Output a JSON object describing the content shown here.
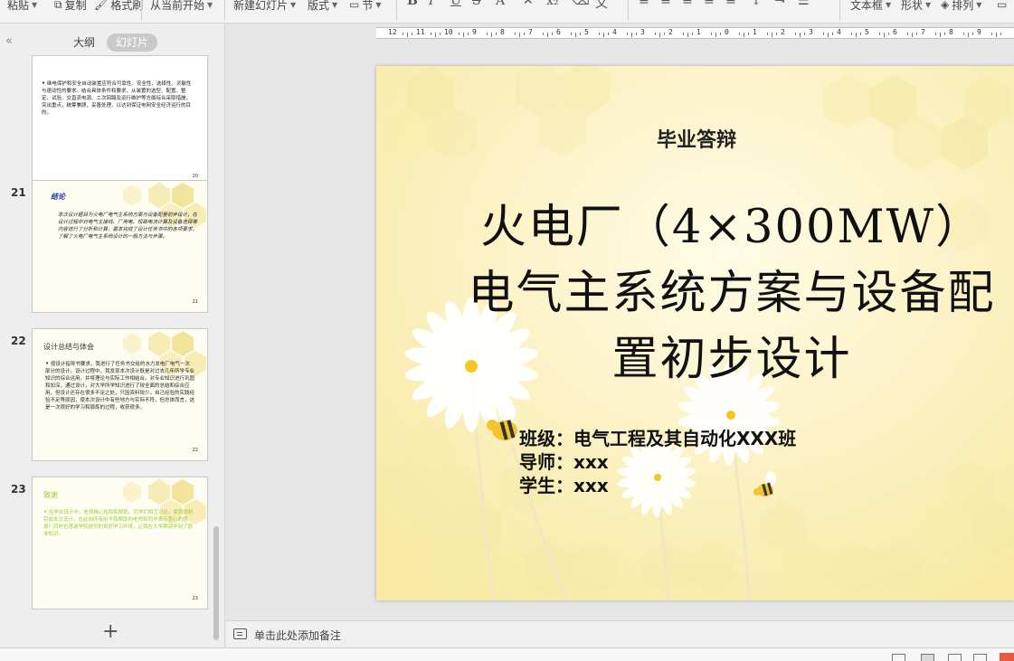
{
  "toolbar": {
    "paste": "粘贴",
    "copy": "复制",
    "format_painter": "格式刷",
    "from_current": "从当前开始",
    "new_slide": "新建幻灯片",
    "layout": "版式",
    "section": "节",
    "bold": "B",
    "italic": "I",
    "underline": "U",
    "strike": "S",
    "textbox": "文本框",
    "shapes": "形状",
    "arrange": "排列"
  },
  "left_panel": {
    "collapse": "«",
    "tab_outline": "大纲",
    "tab_slides": "幻灯片",
    "add_slide": "+",
    "thumbnails": [
      {
        "number": "",
        "title": "",
        "body": "继电保护和安全自动装置应符合可靠性、安全性、选择性、灵敏性与速动性的要求。结合具体条件和要求，从装置的选型、配置、整定、试验、交直流电源、二次回路及运行维护等方面综合采取措施，突出重点，统筹兼顾，妥善处理，以达到保证电网安全经济运行的目的。",
        "page": "20"
      },
      {
        "number": "21",
        "title": "结论",
        "body": "本次设计题目为火电厂电气主系统方案与设备配置初步设计，在设计过程中对电气主接线、厂用电、短路电流计算及设备选择等内容进行了分析和计算，基本完成了设计任务书中的各项要求，了解了火电厂电气主系统设计的一般方法与步骤。",
        "page": "21"
      },
      {
        "number": "22",
        "title": "设计总结与体会",
        "body": "按设计指导书要求，我进行了任务书交给的水力发电厂电气一次部分的设计。设计过程中，我发现本次设计既是对过去几年所学专业知识的综合运用，并将理论与实际工作相结合。对专业知识进行巩固和加深，通过设计，对大学所学知识进行了较全面的总结和综合应用，但设计还存在很多不足之处，只因资料较少，自己经验的实践经验不足等原因，使本次设计中有些地方与实际不符，但总体而言，这是一次很好的学习和锻炼的过程，收获很多。",
        "page": "22"
      },
      {
        "number": "23",
        "title": "致谢",
        "body": "在毕业设计中，老师精心指导和帮助，同学们相互讨论，使我顺利完成本次设计。在此向所有给予我帮助的老师和同学表示衷心的感谢！同时也感谢学院提供的良好学习环境，让我在大学期间学到了很多知识。",
        "page": "23"
      }
    ]
  },
  "ruler": {
    "labels": [
      "12",
      "11",
      "10",
      "9",
      "8",
      "7",
      "6",
      "5",
      "4",
      "3",
      "2",
      "1",
      "0",
      "1",
      "2",
      "3",
      "4",
      "5",
      "6",
      "7",
      "8",
      "9"
    ]
  },
  "slide": {
    "subtitle": "毕业答辩",
    "title_line1": "火电厂（4×300MW）",
    "title_line2": "电气主系统方案与设备配",
    "title_line3": "置初步设计",
    "class_line": "班级：电气工程及其自动化XXX班",
    "teacher_line": "导师：xxx",
    "student_line": "学生：xxx"
  },
  "notes": {
    "placeholder": "单击此处添加备注"
  },
  "colors": {
    "slide_bg": "#fdf6d4",
    "honeycomb": "#f6e9a8",
    "thumb_title_blue": "#1f3c9a",
    "thumb_text_green": "#9acd32",
    "status_accent": "#e85a3c"
  }
}
